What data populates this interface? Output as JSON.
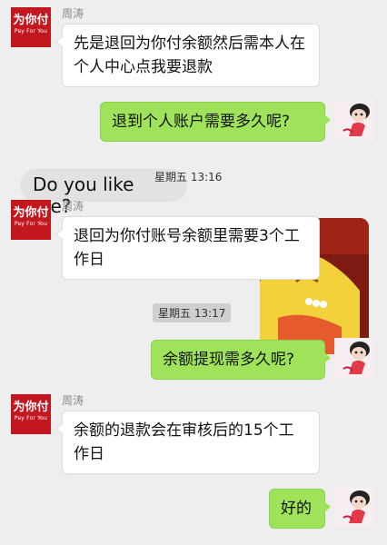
{
  "contact": {
    "name": "周涛",
    "avatar_text": "为你付",
    "avatar_subtext": "Pay For You",
    "avatar_color": "#c3171f"
  },
  "messages": {
    "m1": "先是退回为你付余额然后需本人在个人中心点我要退款",
    "m2": "退到个人账户需要多久呢?",
    "m3": "退回为你付账号余额里需要3个工作日",
    "m4": "余额提现需多久呢?",
    "m5": "余额的退款会在审核后的15个工作日",
    "m6": "好的"
  },
  "overlay": {
    "text": "Do you like me?"
  },
  "timestamps": {
    "t1": "星期五 13:16",
    "t2": "星期五 13:17"
  },
  "colors": {
    "left_bubble": "#ffffff",
    "right_bubble": "#9ee35a",
    "background": "#eeeeee"
  }
}
